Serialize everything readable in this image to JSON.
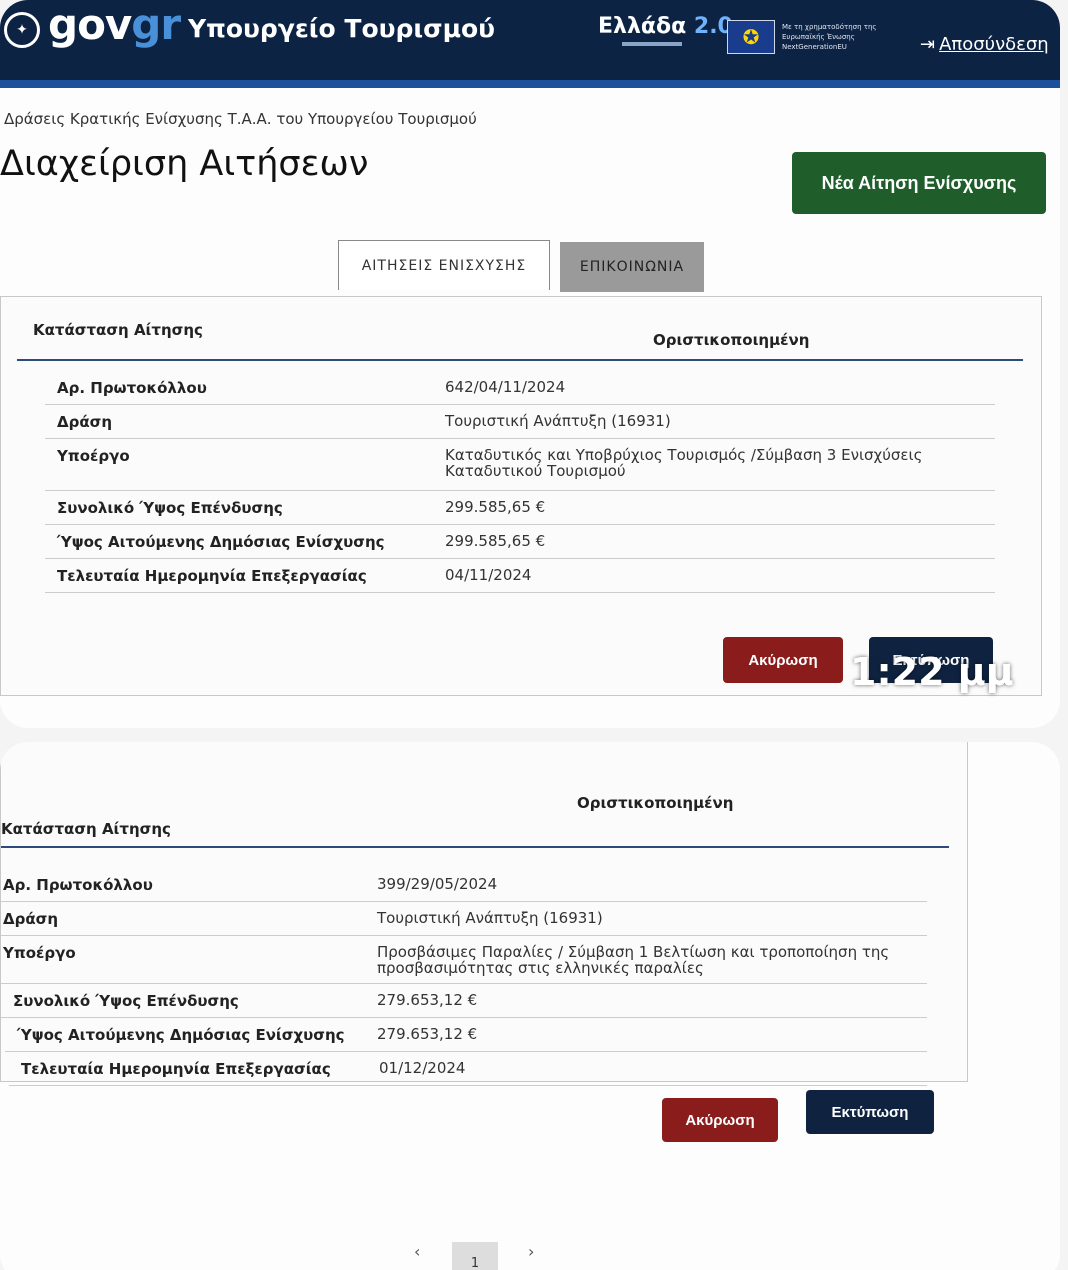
{
  "header": {
    "logo_main": "gov",
    "logo_accent": "gr",
    "ministry": "Υπουργείο Τουρισμού",
    "program_name": "Ελλάδα",
    "program_version": "2.0",
    "eu_text": "Με τη χρηματοδότηση της Ευρωπαϊκής Ένωσης NextGenerationEU",
    "logout": "Αποσύνδεση"
  },
  "breadcrumb": "Δράσεις Κρατικής Ενίσχυσης Τ.Α.Α. του Υπουργείου Τουρισμού",
  "page_title": "Διαχείριση Αιτήσεων",
  "new_application_button": "Νέα Αίτηση Ενίσχυσης",
  "tabs": [
    {
      "label": "ΑΙΤΗΣΕΙΣ ΕΝΙΣΧΥΣΗΣ",
      "active": true
    },
    {
      "label": "ΕΠΙΚΟΙΝΩΝΙΑ",
      "active": false
    }
  ],
  "applications": [
    {
      "status_label": "Κατάσταση Αίτησης",
      "status_value": "Οριστικοποιημένη",
      "rows": [
        {
          "label": "Αρ. Πρωτοκόλλου",
          "value": "642/04/11/2024"
        },
        {
          "label": "Δράση",
          "value": "Τουριστική Ανάπτυξη (16931)"
        },
        {
          "label": "Υποέργο",
          "value": "Καταδυτικός και Υποβρύχιος Τουρισμός /Σύμβαση 3 Ενισχύσεις Καταδυτικού Τουρισμού"
        },
        {
          "label": "Συνολικό Ύψος Επένδυσης",
          "value": "299.585,65 €"
        },
        {
          "label": "Ύψος Αιτούμενης Δημόσιας Ενίσχυσης",
          "value": "299.585,65 €"
        },
        {
          "label": "Τελευταία Ημερομηνία Επεξεργασίας",
          "value": "04/11/2024"
        }
      ],
      "cancel_button": "Ακύρωση",
      "print_button": "Εκτύπωση"
    },
    {
      "status_label": "Κατάσταση Αίτησης",
      "status_value": "Οριστικοποιημένη",
      "rows": [
        {
          "label": "Αρ. Πρωτοκόλλου",
          "value": "399/29/05/2024"
        },
        {
          "label": "Δράση",
          "value": "Τουριστική Ανάπτυξη (16931)"
        },
        {
          "label": "Υποέργο",
          "value": "Προσβάσιμες Παραλίες / Σύμβαση 1 Βελτίωση και τροποποίηση της προσβασιμότητας στις ελληνικές παραλίες"
        },
        {
          "label": "Συνολικό Ύψος Επένδυσης",
          "value": "279.653,12 €"
        },
        {
          "label": "Ύψος Αιτούμενης Δημόσιας Ενίσχυσης",
          "value": "279.653,12 €"
        },
        {
          "label": "Τελευταία Ημερομηνία Επεξεργασίας",
          "value": "01/12/2024"
        }
      ],
      "cancel_button": "Ακύρωση",
      "print_button": "Εκτύπωση"
    }
  ],
  "timestamp": "1:22 μμ",
  "pagination": {
    "prev": "‹",
    "current": "1",
    "next": "›"
  }
}
